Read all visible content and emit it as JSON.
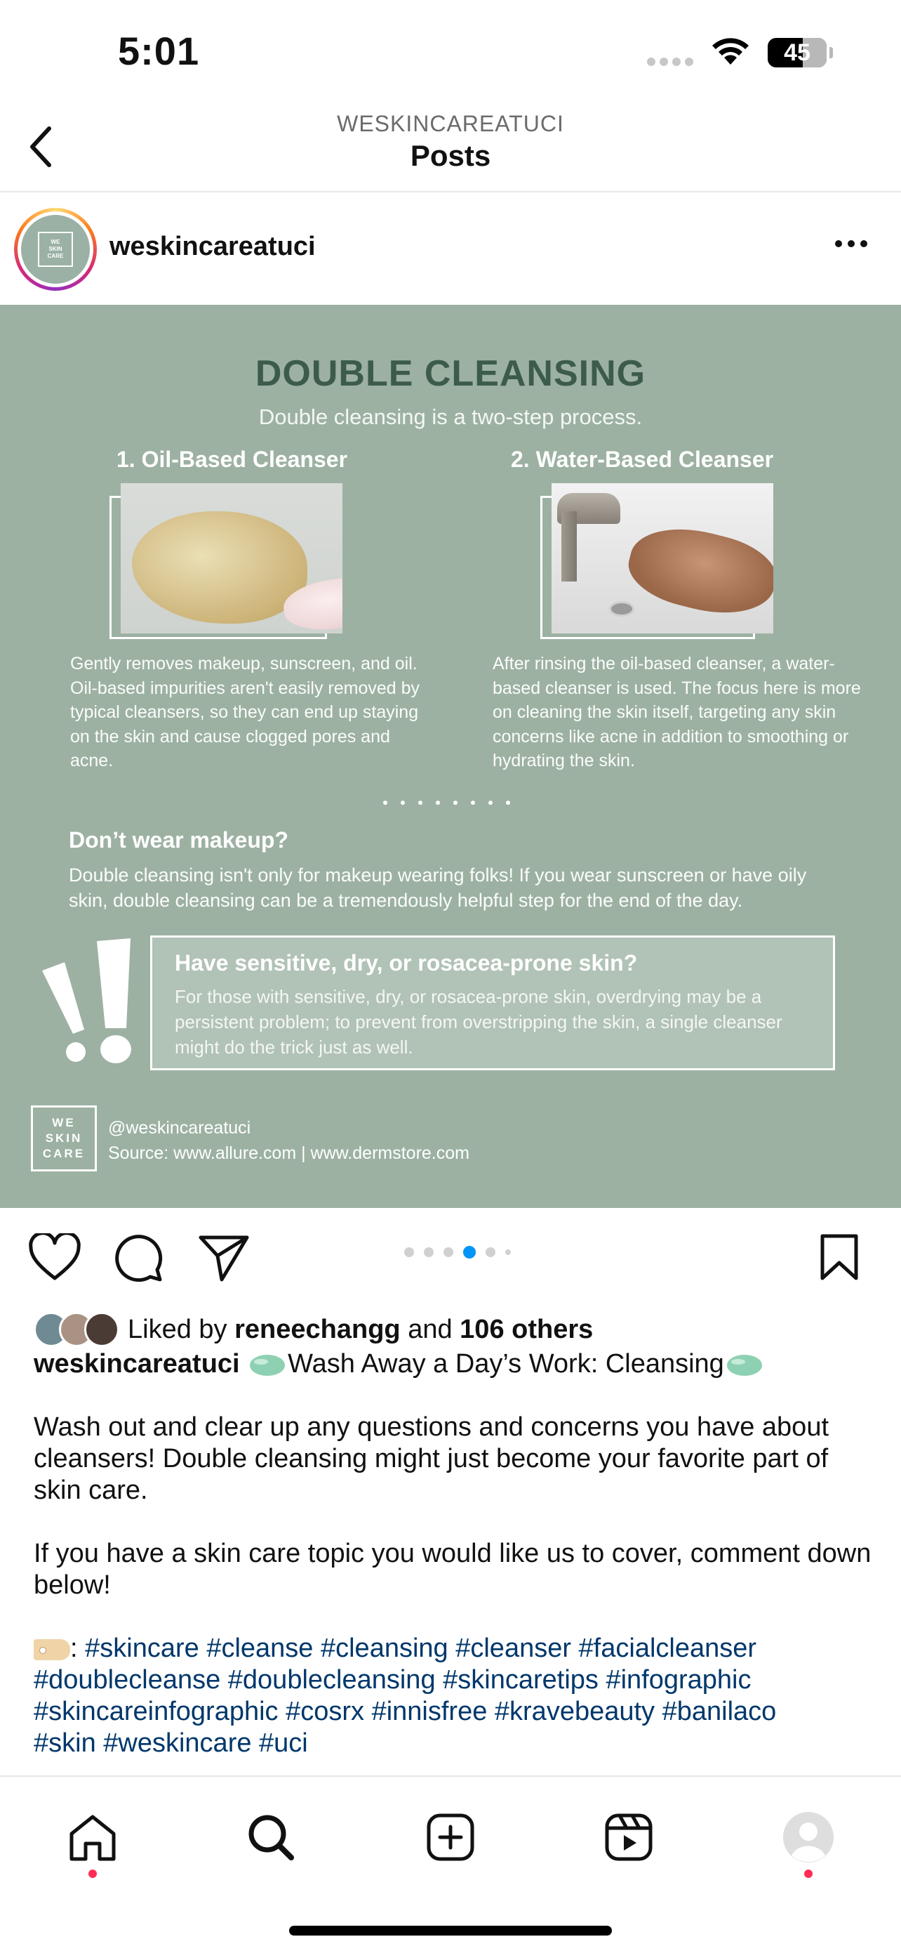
{
  "status_bar": {
    "time": "5:01",
    "battery": "45"
  },
  "header": {
    "account": "WESKINCAREATUCI",
    "title": "Posts"
  },
  "post": {
    "username": "weskincareatuci",
    "avatar_text": [
      "WE",
      "SKIN",
      "CARE"
    ]
  },
  "infographic": {
    "title": "DOUBLE CLEANSING",
    "subtitle": "Double cleansing is a two-step process.",
    "col1_title": "1. Oil-Based Cleanser",
    "col1_text": "Gently removes makeup, sunscreen, and oil. Oil-based impurities aren't easily removed by typical cleansers, so they can end up staying on the skin and cause clogged pores and acne.",
    "col2_title": "2. Water-Based Cleanser",
    "col2_text": "After rinsing the oil-based cleanser, a water-based cleanser is used. The focus here is more on cleaning the skin itself, targeting any skin concerns like acne in addition to smoothing or hydrating the skin.",
    "makeup_title": "Don’t wear makeup?",
    "makeup_text": "Double cleansing isn't only for makeup wearing folks! If you wear sunscreen or have oily skin, double cleansing can be a tremendously helpful step for the end of the day.",
    "sensitive_title": "Have sensitive, dry, or rosacea-prone skin?",
    "sensitive_text": "For those with sensitive, dry, or rosacea-prone skin, overdrying may be a persistent problem; to prevent from overstripping the skin, a single cleanser might do the trick just as well.",
    "logo_lines": [
      "WE",
      "SKIN",
      "CARE"
    ],
    "handle": "@weskincareatuci",
    "source": "Source: www.allure.com | www.dermstore.com"
  },
  "carousel": {
    "total": 6,
    "active_index": 3
  },
  "likes": {
    "prefix": "Liked by",
    "user": "reneechangg",
    "middle": "and",
    "others": "106 others"
  },
  "caption": {
    "username": "weskincareatuci",
    "headline": "Wash Away a Day’s Work: Cleansing",
    "paragraph1": "Wash out and clear up any questions and concerns you have about cleansers! Double cleansing might just become your favorite part of skin care.",
    "paragraph2": "If you have a skin care topic you would like us to cover, comment down below!",
    "tag_prefix": ":",
    "hashtags_line1": "#skincare #cleanse #cleansing #cleanser #facialcleanser",
    "hashtags_line2": "#doublecleanse #doublecleansing #skincaretips #infographic",
    "hashtags_line3": "#skincareinfographic #cosrx #innisfree #kravebeauty #banilaco",
    "hashtags_line4": "#skin #weskincare #uci"
  },
  "icons": {
    "back": "chevron-left-icon",
    "more": "more-horizontal-icon",
    "like": "heart-icon",
    "comment": "comment-icon",
    "share": "send-icon",
    "save": "bookmark-icon",
    "tabs": [
      "home-icon",
      "search-icon",
      "create-icon",
      "reels-icon",
      "profile-icon"
    ]
  },
  "colors": {
    "infographic_bg": "#9cb1a2",
    "title_green": "#3c5b4b",
    "hashtag": "#00376b",
    "notification_dot": "#ff2d55",
    "active_dot": "#0095f6"
  }
}
